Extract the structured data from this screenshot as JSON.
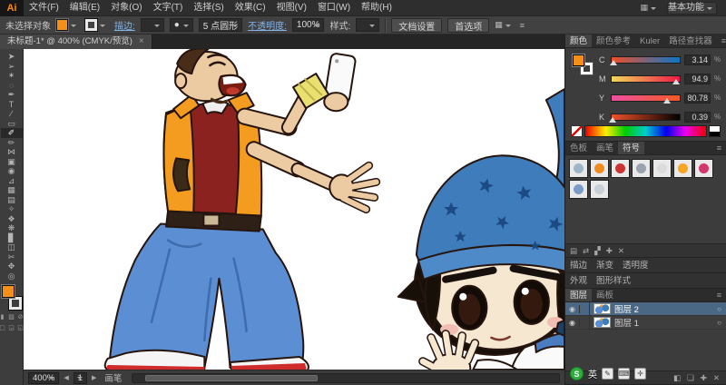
{
  "icons": {
    "eye": "◉",
    "target": "○",
    "menu": "≡",
    "close": "×",
    "arrow_left": "◀",
    "arrow_right": "▶",
    "grid": "▦",
    "dot": "●"
  },
  "app": {
    "logo_text": "Ai",
    "workspace_label": "基本功能",
    "menu_items": [
      "文件(F)",
      "编辑(E)",
      "对象(O)",
      "文字(T)",
      "选择(S)",
      "效果(C)",
      "视图(V)",
      "窗口(W)",
      "帮助(H)"
    ]
  },
  "controlbar": {
    "selection_status": "未选择对象",
    "stroke_link": "描边:",
    "brush_name": "5 点圆形",
    "opacity_link": "不透明度:",
    "opacity_value": "100%",
    "style_label": "样式:",
    "document_setup": "文档设置",
    "preferences": "首选项"
  },
  "document_tab": {
    "title": "未标题-1* @ 400% (CMYK/预览)"
  },
  "tools": [
    {
      "data_name": "selection-tool",
      "glyph": "➤"
    },
    {
      "data_name": "direct-selection-tool",
      "glyph": "➢"
    },
    {
      "data_name": "magic-wand-tool",
      "glyph": "✶"
    },
    {
      "data_name": "lasso-tool",
      "glyph": "◌"
    },
    {
      "data_name": "pen-tool",
      "glyph": "✒"
    },
    {
      "data_name": "type-tool",
      "glyph": "T"
    },
    {
      "data_name": "line-segment-tool",
      "glyph": "∕"
    },
    {
      "data_name": "rectangle-tool",
      "glyph": "▭"
    },
    {
      "data_name": "paintbrush-tool",
      "glyph": "✐"
    },
    {
      "data_name": "pencil-tool",
      "glyph": "✏"
    },
    {
      "data_name": "width-tool",
      "glyph": "⋈"
    },
    {
      "data_name": "free-transform-tool",
      "glyph": "▣"
    },
    {
      "data_name": "shape-builder-tool",
      "glyph": "◉"
    },
    {
      "data_name": "perspective-grid-tool",
      "glyph": "⊿"
    },
    {
      "data_name": "mesh-tool",
      "glyph": "▦"
    },
    {
      "data_name": "gradient-tool",
      "glyph": "▤"
    },
    {
      "data_name": "eyedropper-tool",
      "glyph": "✧"
    },
    {
      "data_name": "blend-tool",
      "glyph": "❖"
    },
    {
      "data_name": "symbol-sprayer-tool",
      "glyph": "❋"
    },
    {
      "data_name": "column-graph-tool",
      "glyph": "▊"
    },
    {
      "data_name": "artboard-tool",
      "glyph": "◫"
    },
    {
      "data_name": "slice-tool",
      "glyph": "✂"
    },
    {
      "data_name": "hand-tool",
      "glyph": "✥"
    },
    {
      "data_name": "zoom-tool",
      "glyph": "◎"
    }
  ],
  "statusbar": {
    "zoom_value": "400%",
    "artboard_number": "1",
    "tool_status": "画笔"
  },
  "panels": {
    "color_group_tabs": [
      "颜色",
      "颜色参考",
      "Kuler",
      "路径查找器"
    ],
    "color": {
      "unit": "%",
      "channels": [
        {
          "label": "C",
          "value": "3.14"
        },
        {
          "label": "M",
          "value": "94.9"
        },
        {
          "label": "Y",
          "value": "80.78"
        },
        {
          "label": "K",
          "value": "0.39"
        }
      ]
    },
    "swatch_group_tabs": [
      "色板",
      "画笔",
      "符号"
    ],
    "symbols_footer": [
      {
        "data_name": "symbol-library-icon",
        "glyph": "▤"
      },
      {
        "data_name": "place-symbol-icon",
        "glyph": "⇄"
      },
      {
        "data_name": "break-link-icon",
        "glyph": "▞"
      },
      {
        "data_name": "new-symbol-icon",
        "glyph": "✚"
      },
      {
        "data_name": "delete-symbol-icon",
        "glyph": "✕"
      }
    ],
    "collapsed_group_1": [
      "描边",
      "渐变",
      "透明度"
    ],
    "collapsed_group_2": [
      "外观",
      "图形样式"
    ],
    "layers_group_tabs": [
      "图层",
      "画板"
    ],
    "layers": [
      {
        "data_name": "layer-row-2",
        "name": "图层 2",
        "selected": true
      },
      {
        "data_name": "layer-row-1",
        "name": "图层 1",
        "selected": false
      }
    ],
    "layers_footer": [
      {
        "data_name": "make-mask-icon",
        "glyph": "◧"
      },
      {
        "data_name": "new-sublayer-icon",
        "glyph": "❏"
      },
      {
        "data_name": "new-layer-icon",
        "glyph": "✚"
      },
      {
        "data_name": "delete-layer-icon",
        "glyph": "✕"
      }
    ]
  },
  "tray": {
    "logo_glyph": "S",
    "mode_label": "英",
    "icons": [
      {
        "data_name": "ime-pencil-icon",
        "glyph": "✎"
      },
      {
        "data_name": "ime-keyboard-icon",
        "glyph": "⌨"
      },
      {
        "data_name": "ime-toolbox-icon",
        "glyph": "✛"
      }
    ]
  },
  "colors": {
    "accent_orange": "#f39019",
    "selection_blue": "#4a6784",
    "jeans_blue": "#5b8ed2",
    "bandana_blue": "#3e7cbb",
    "vest_orange": "#f39c1f",
    "shirt_maroon": "#8c2220"
  }
}
